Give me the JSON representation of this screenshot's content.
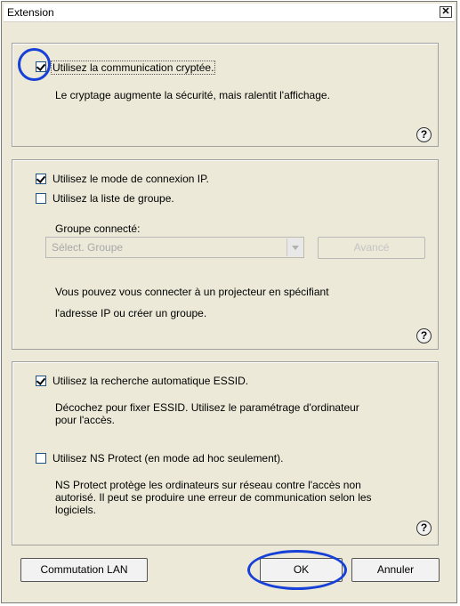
{
  "window": {
    "title": "Extension",
    "close_glyph": "✕"
  },
  "section1": {
    "encryption_label": "Utilisez la communication cryptée.",
    "encryption_checked": true,
    "encryption_desc": "Le cryptage augmente la sécurité, mais ralentit l'affichage."
  },
  "section2": {
    "ip_mode_label": "Utilisez le mode de connexion IP.",
    "ip_mode_checked": true,
    "group_list_label": "Utilisez la liste de groupe.",
    "group_list_checked": false,
    "connected_group_label": "Groupe connecté:",
    "group_select_value": "Sélect. Groupe",
    "advanced_label": "Avancé",
    "desc_line1": "Vous pouvez vous connecter à un projecteur en spécifiant",
    "desc_line2": "l'adresse IP ou créer un groupe."
  },
  "section3": {
    "essid_label": "Utilisez la recherche automatique ESSID.",
    "essid_checked": true,
    "essid_desc_line1": "Décochez pour fixer ESSID. Utilisez le paramétrage d'ordinateur",
    "essid_desc_line2": "pour l'accès.",
    "ns_protect_label": "Utilisez NS Protect (en mode ad hoc seulement).",
    "ns_protect_checked": false,
    "ns_desc_line1": "NS Protect protège les ordinateurs sur réseau contre l'accès non",
    "ns_desc_line2": "autorisé. Il peut se produire une erreur de communication selon les",
    "ns_desc_line3": "logiciels."
  },
  "help_glyph": "?",
  "footer": {
    "lan_switch_label": "Commutation LAN",
    "ok_label": "OK",
    "cancel_label": "Annuler"
  },
  "colors": {
    "annotation_circle": "#1640d8",
    "dialog_bg": "#ece9d8"
  }
}
